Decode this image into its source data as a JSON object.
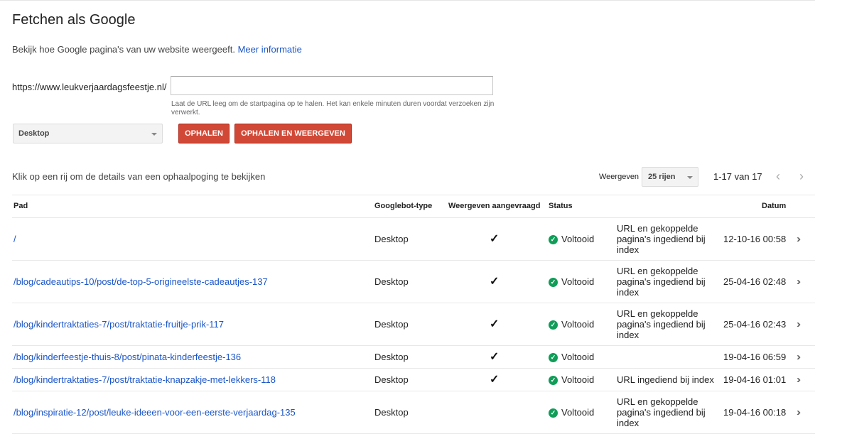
{
  "page": {
    "title": "Fetchen als Google",
    "description": "Bekijk hoe Google pagina's van uw website weergeeft.",
    "more_info_link": "Meer informatie"
  },
  "fetch_form": {
    "url_prefix": "https://www.leukverjaardagsfeestje.nl/",
    "url_value": "",
    "hint": "Laat de URL leeg om de startpagina op te halen. Het kan enkele minuten duren voordat verzoeken zijn verwerkt.",
    "device_selected": "Desktop",
    "fetch_button": "OPHALEN",
    "fetch_render_button": "OPHALEN EN WEERGEVEN",
    "button_color": "#d14836"
  },
  "table_controls": {
    "info": "Klik op een rij om de details van een ophaalpoging te bekijken",
    "show_label": "Weergeven",
    "rows_selected": "25 rijen",
    "range": "1-17 van 17",
    "prev_icon": "chevron-left-icon",
    "next_icon": "chevron-right-icon"
  },
  "table": {
    "headers": {
      "path": "Pad",
      "bot_type": "Googlebot-type",
      "render_requested": "Weergeven aangevraagd",
      "status": "Status",
      "date": "Datum"
    },
    "status_color": "#0f9d58",
    "link_color": "#1a55c9",
    "rows": [
      {
        "path": "/",
        "bot": "Desktop",
        "render": "✓",
        "status": "Voltooid",
        "detail": "URL en gekoppelde pagina's ingediend bij index",
        "date": "12-10-16 00:58"
      },
      {
        "path": "/blog/cadeautips-10/post/de-top-5-origineelste-cadeautjes-137",
        "bot": "Desktop",
        "render": "✓",
        "status": "Voltooid",
        "detail": "URL en gekoppelde pagina's ingediend bij index",
        "date": "25-04-16 02:48"
      },
      {
        "path": "/blog/kindertraktaties-7/post/traktatie-fruitje-prik-117",
        "bot": "Desktop",
        "render": "✓",
        "status": "Voltooid",
        "detail": "URL en gekoppelde pagina's ingediend bij index",
        "date": "25-04-16 02:43"
      },
      {
        "path": "/blog/kinderfeestje-thuis-8/post/pinata-kinderfeestje-136",
        "bot": "Desktop",
        "render": "✓",
        "status": "Voltooid",
        "detail": "",
        "date": "19-04-16 06:59"
      },
      {
        "path": "/blog/kindertraktaties-7/post/traktatie-knapzakje-met-lekkers-118",
        "bot": "Desktop",
        "render": "✓",
        "status": "Voltooid",
        "detail": "URL ingediend bij index",
        "date": "19-04-16 01:01"
      },
      {
        "path": "/blog/inspiratie-12/post/leuke-ideeen-voor-een-eerste-verjaardag-135",
        "bot": "Desktop",
        "render": "",
        "status": "Voltooid",
        "detail": "URL en gekoppelde pagina's ingediend bij index",
        "date": "19-04-16 00:18"
      }
    ]
  }
}
